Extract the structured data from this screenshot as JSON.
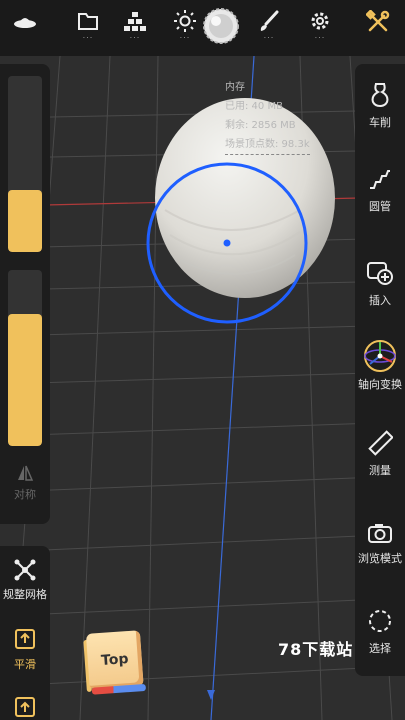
{
  "top_menu_dots": "...",
  "stats": {
    "title": "内存",
    "used": "已用: 40 MB",
    "free": "剩余: 2856 MB",
    "vertices": "场景顶点数: 98.3k"
  },
  "left_panel": {
    "slider1_level": 0.35,
    "slider2_level": 0.75,
    "symmetry_label": "对称"
  },
  "left_tools": {
    "remesh_label": "规整网格",
    "smooth_label": "平滑"
  },
  "right_tools": [
    {
      "label": "车削",
      "icon": "vase-icon"
    },
    {
      "label": "圆管",
      "icon": "tube-icon"
    },
    {
      "label": "插入",
      "icon": "insert-icon"
    },
    {
      "label": "轴向变换",
      "icon": "gizmo-icon"
    },
    {
      "label": "测量",
      "icon": "ruler-icon"
    },
    {
      "label": "浏览模式",
      "icon": "camera-icon"
    },
    {
      "label": "选择",
      "icon": "select-icon"
    }
  ],
  "view_cube_label": "Top",
  "watermark": "78下载站",
  "colors": {
    "accent": "#f0c15c",
    "brush_ring": "#1f5fff",
    "axis_red": "#b03a3a",
    "axis_blue": "#3a6ad8"
  }
}
